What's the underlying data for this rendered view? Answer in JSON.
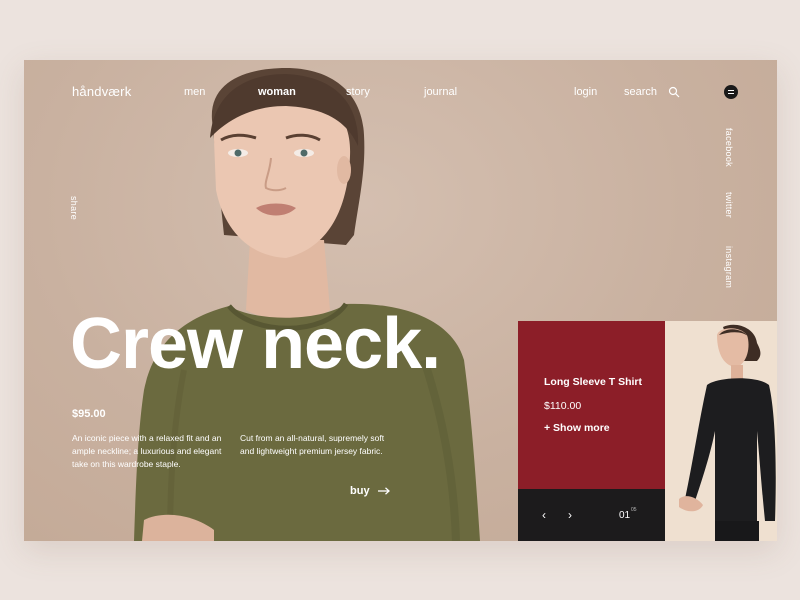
{
  "brand": {
    "logo": "håndværk"
  },
  "nav": {
    "items": [
      "men",
      "woman",
      "story",
      "journal"
    ],
    "login": "login",
    "search": "search"
  },
  "social": {
    "share": "share",
    "facebook": "facebook",
    "twitter": "twitter",
    "instagram": "instagram"
  },
  "hero": {
    "headline": "Crew neck.",
    "price": "$95.00",
    "desc_left": "An iconic piece with a relaxed fit and an ample neckline; a luxurious and elegant take on this wardrobe staple.",
    "desc_right": "Cut from an all-natural, supremely soft and lightweight premium jersey fabric.",
    "buy_label": "buy"
  },
  "product_card": {
    "name": "Long Sleeve T Shirt",
    "price": "$110.00",
    "more": "+ Show more",
    "page": "01",
    "page_total": "05"
  },
  "colors": {
    "frame_bg": "#cbb4a3",
    "card_red": "#8c1e28",
    "card_dark": "#1c1b1c",
    "shirt_olive": "#6b6a3f",
    "page_bg": "#ece3de"
  },
  "icons": [
    "search-icon",
    "menu-icon",
    "arrow-right-icon",
    "chevron-left-icon",
    "chevron-right-icon"
  ]
}
